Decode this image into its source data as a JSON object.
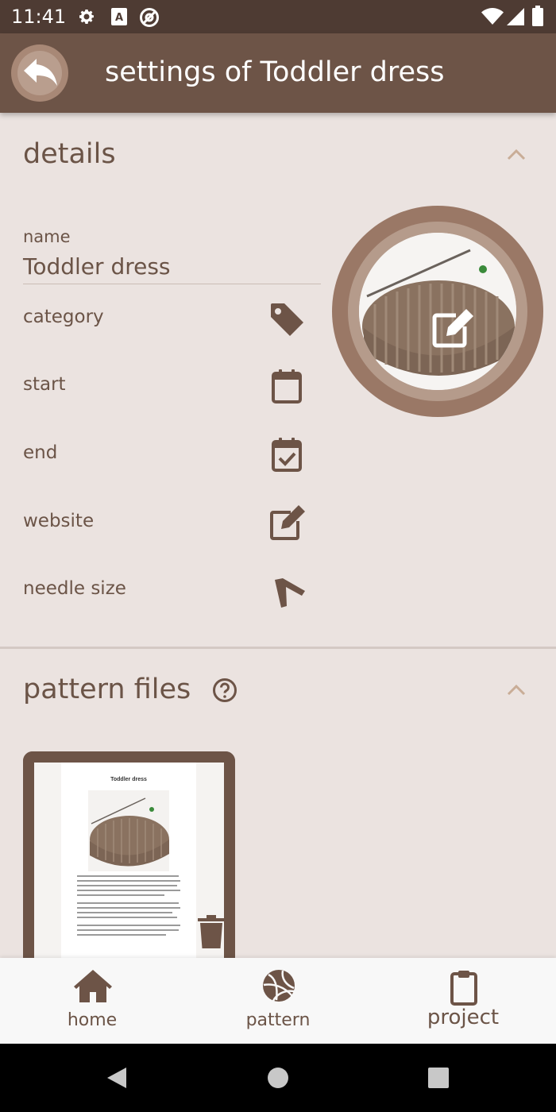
{
  "status_bar": {
    "time": "11:41",
    "icons": [
      "gear-icon",
      "a-box-icon",
      "at-sign-icon",
      "wifi-icon",
      "signal-icon",
      "battery-icon"
    ]
  },
  "app_bar": {
    "back_icon": "reply-arrow-icon",
    "title": "settings of Toddler dress"
  },
  "details": {
    "title": "details",
    "name_label": "name",
    "name_value": "Toddler dress",
    "rows": [
      {
        "label": "category",
        "icon": "tag-icon"
      },
      {
        "label": "start",
        "icon": "calendar-icon"
      },
      {
        "label": "end",
        "icon": "calendar-check-icon"
      },
      {
        "label": "website",
        "icon": "edit-square-icon"
      },
      {
        "label": "needle size",
        "icon": "needle-icon"
      }
    ],
    "photo_edit_icon": "edit-square-icon"
  },
  "pattern_files": {
    "title": "pattern files",
    "help_icon": "question-circle-icon",
    "files": [
      {
        "doc_title": "Toddler dress",
        "delete_icon": "trash-icon"
      }
    ]
  },
  "bottom_nav": {
    "items": [
      {
        "label": "home",
        "icon": "home-icon"
      },
      {
        "label": "pattern",
        "icon": "yarn-ball-icon"
      },
      {
        "label": "project",
        "icon": "clipboard-icon"
      }
    ]
  },
  "colors": {
    "primary": "#6d5447",
    "status_bar": "#4e3b33",
    "background": "#ebe3e0",
    "text": "#6b5447",
    "chevron": "#c9ad97"
  }
}
